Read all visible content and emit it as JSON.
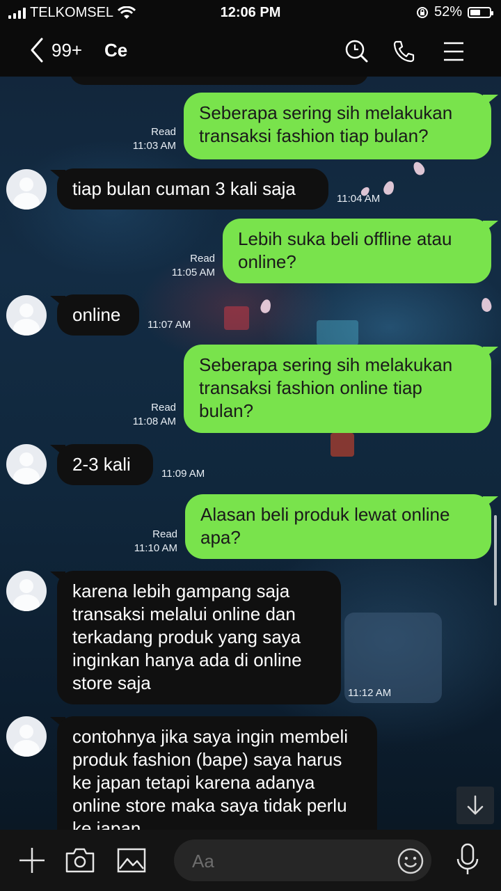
{
  "status_bar": {
    "carrier": "TELKOMSEL",
    "time": "12:06 PM",
    "battery": "52%",
    "battery_level": 0.52
  },
  "header": {
    "unread_count": "99+",
    "contact_name": "Ce",
    "icons": [
      "back-chevron-icon",
      "search-icon",
      "phone-icon",
      "menu-icon"
    ]
  },
  "messages": [
    {
      "dir": "out",
      "text": "Seberapa sering sih melakukan transaksi fashion tiap bulan?",
      "status": "Read",
      "time": "11:03 AM"
    },
    {
      "dir": "in",
      "text": "tiap bulan cuman 3 kali saja",
      "time": "11:04 AM"
    },
    {
      "dir": "out",
      "text": "Lebih suka beli offline atau online?",
      "status": "Read",
      "time": "11:05 AM"
    },
    {
      "dir": "in",
      "text": "online",
      "time": "11:07 AM"
    },
    {
      "dir": "out",
      "text": "Seberapa sering sih melakukan transaksi fashion online tiap bulan?",
      "status": "Read",
      "time": "11:08 AM"
    },
    {
      "dir": "in",
      "text": "2-3 kali",
      "time": "11:09 AM"
    },
    {
      "dir": "out",
      "text": "Alasan beli produk lewat online apa?",
      "status": "Read",
      "time": "11:10 AM"
    },
    {
      "dir": "in",
      "text": "karena lebih gampang saja transaksi melalui online dan terkadang produk yang saya inginkan hanya ada di online store saja",
      "time": "11:12 AM"
    },
    {
      "dir": "in",
      "text": "contohnya jika saya ingin membeli produk fashion (bape) saya harus ke japan tetapi karena adanya online store maka saya tidak perlu ke japan"
    }
  ],
  "composer": {
    "placeholder": "Aa",
    "icons": [
      "plus-icon",
      "camera-icon",
      "image-icon",
      "emoji-icon",
      "microphone-icon"
    ]
  },
  "colors": {
    "outgoing_bubble": "#79e34c",
    "incoming_bubble": "#101010",
    "bars": "#0b0b0b"
  }
}
